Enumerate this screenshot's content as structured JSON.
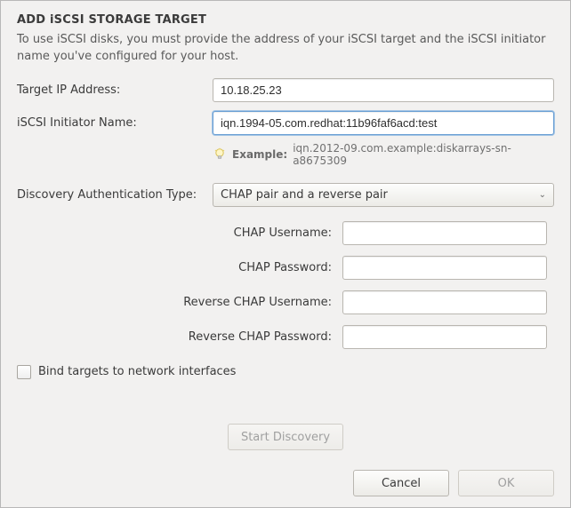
{
  "dialog": {
    "title": "ADD iSCSI STORAGE TARGET",
    "description": "To use iSCSI disks, you must provide the address of your iSCSI target and the iSCSI initiator name you've configured for your host."
  },
  "fields": {
    "target_ip": {
      "label": "Target IP Address:",
      "value": "10.18.25.23"
    },
    "initiator": {
      "label": "iSCSI Initiator Name:",
      "value": "iqn.1994-05.com.redhat:11b96faf6acd:test"
    },
    "example": {
      "label": "Example:",
      "text": "iqn.2012-09.com.example:diskarrays-sn-a8675309"
    },
    "auth_type": {
      "label": "Discovery Authentication Type:",
      "selected": "CHAP pair and a reverse pair"
    },
    "chap_user": {
      "label": "CHAP Username:",
      "value": ""
    },
    "chap_pass": {
      "label": "CHAP Password:",
      "value": ""
    },
    "rchap_user": {
      "label": "Reverse CHAP Username:",
      "value": ""
    },
    "rchap_pass": {
      "label": "Reverse CHAP Password:",
      "value": ""
    },
    "bind": {
      "label": "Bind targets to network interfaces",
      "checked": false
    }
  },
  "buttons": {
    "start_discovery": "Start Discovery",
    "cancel": "Cancel",
    "ok": "OK"
  }
}
